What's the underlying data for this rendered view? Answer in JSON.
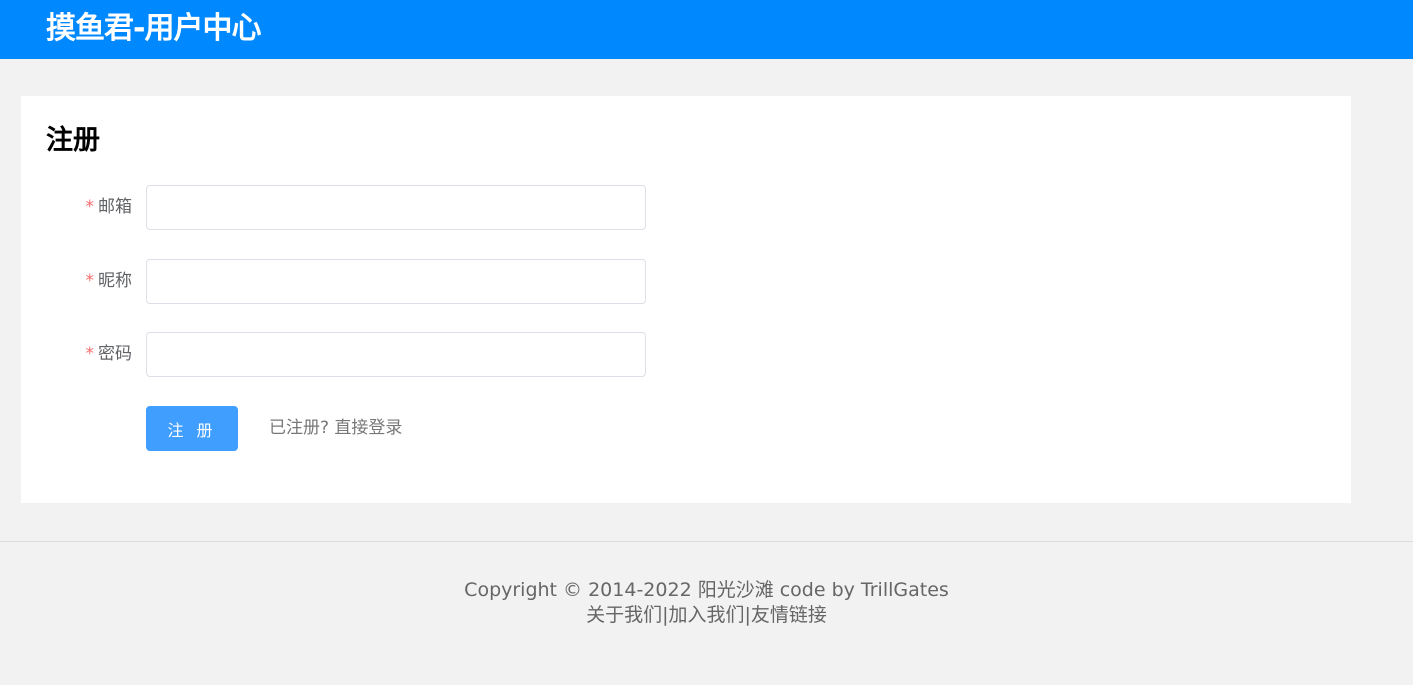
{
  "header": {
    "title": "摸鱼君-用户中心"
  },
  "form": {
    "title": "注册",
    "required_mark": "*",
    "fields": [
      {
        "label": "邮箱",
        "value": "",
        "placeholder": ""
      },
      {
        "label": "昵称",
        "value": "",
        "placeholder": ""
      },
      {
        "label": "密码",
        "value": "",
        "placeholder": ""
      }
    ],
    "submit_label": "注 册",
    "login_link": "已注册? 直接登录"
  },
  "footer": {
    "copyright": "Copyright © 2014-2022 阳光沙滩 code by TrillGates",
    "links": [
      {
        "label": "关于我们"
      },
      {
        "label": "加入我们"
      },
      {
        "label": "友情链接"
      }
    ],
    "separator": "|"
  }
}
